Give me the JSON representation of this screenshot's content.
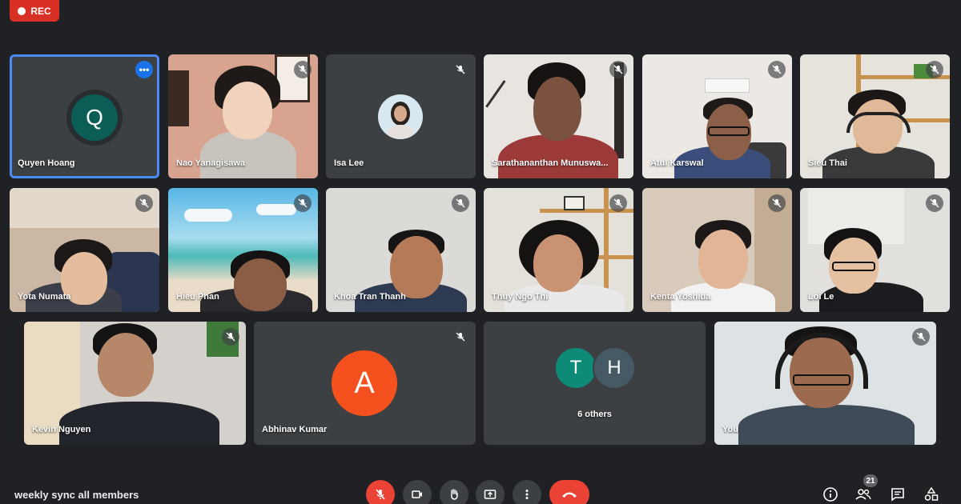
{
  "recording": {
    "label": "REC"
  },
  "meeting": {
    "title": "weekly sync all members"
  },
  "participants": [
    {
      "name": "Quyen Hoang",
      "initial": "Q"
    },
    {
      "name": "Nao Yanagisawa"
    },
    {
      "name": "Isa Lee"
    },
    {
      "name": "Sarathananthan Munuswa..."
    },
    {
      "name": "Atul Karswal"
    },
    {
      "name": "Sieu Thai"
    },
    {
      "name": "Yota Numata"
    },
    {
      "name": "Hieu Phan"
    },
    {
      "name": "Khoa Tran Thanh"
    },
    {
      "name": "Thuy Ngo Thi"
    },
    {
      "name": "Kenta Yoshida"
    },
    {
      "name": "Loi Le"
    },
    {
      "name": "Kevin Nguyen"
    },
    {
      "name": "Abhinav Kumar",
      "initial": "A"
    },
    {
      "name": "You"
    }
  ],
  "others": {
    "label": "6 others",
    "initials": [
      "T",
      "H"
    ]
  },
  "toolbar": {
    "participant_count": "21"
  },
  "colors": {
    "accent": "#4a8af4",
    "rec": "#d93025",
    "end_call": "#ea4335",
    "avatar_q": "#0b5e55",
    "avatar_a": "#f4511e",
    "avatar_t": "#0d8a78",
    "avatar_h": "#455a64"
  }
}
